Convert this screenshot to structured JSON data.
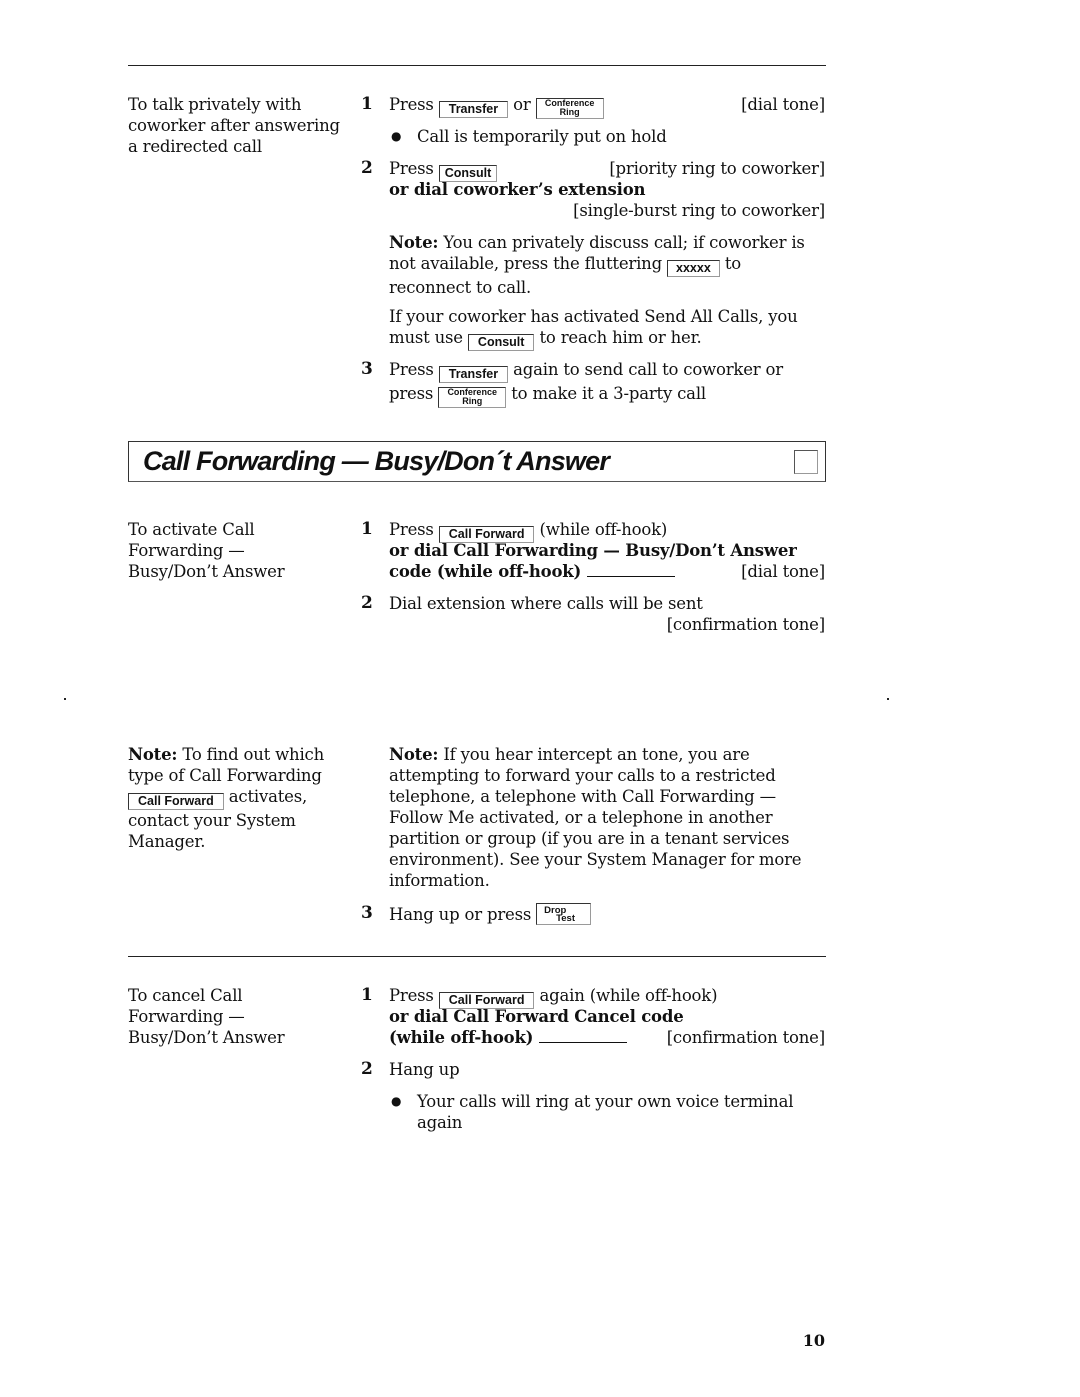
{
  "section1": {
    "left_text": [
      "To talk privately with",
      "coworker after answering",
      "a redirected call"
    ],
    "step1": {
      "number": "1",
      "press": "Press",
      "key_transfer": "Transfer",
      "or": "or",
      "key_conf_line1": "Conference",
      "key_conf_line2": "Ring",
      "tone": "[dial tone]"
    },
    "bullet1": "Call is temporarily put on hold",
    "step2": {
      "number": "2",
      "press": "Press",
      "key_consult": "Consult",
      "tone": "[priority ring to coworker]",
      "alt": "or dial coworker’s extension",
      "alt_tone": "[single-burst ring to coworker]"
    },
    "note1": {
      "label": "Note:",
      "line1": "You can privately discuss call; if coworker is",
      "line2_pre": "not available, press the fluttering",
      "key_xxxxx": "xxxxx",
      "line2_post": "to",
      "line3": "reconnect to call."
    },
    "note2": {
      "line1": "If your coworker has activated Send All Calls, you",
      "line2_pre": "must use",
      "key_consult": "Consult",
      "line2_post": "to reach him or her."
    },
    "step3": {
      "number": "3",
      "press": "Press",
      "key_transfer": "Transfer",
      "line1_post": "again to send call to coworker or",
      "press2": "press",
      "key_conf_line1": "Conference",
      "key_conf_line2": "Ring",
      "line2_post": "to make it a 3-party call"
    }
  },
  "heading": {
    "title": "Call Forwarding — Busy/Don´t Answer",
    "checkbox_icon": "empty-checkbox-icon"
  },
  "activate": {
    "left_text": [
      "To activate Call",
      "Forwarding —",
      "Busy/Don’t Answer"
    ],
    "step1": {
      "number": "1",
      "press": "Press",
      "key_call_forward": "Call Forward",
      "post": "(while off-hook)",
      "alt_line1": "or dial Call Forwarding — Busy/Don’t Answer",
      "alt_line2": "code (while off-hook)",
      "tone": "[dial tone]"
    },
    "step2": {
      "number": "2",
      "text": "Dial extension where calls will be sent",
      "tone": "[confirmation tone]"
    },
    "side_note": {
      "label": "Note:",
      "line1": "To find out which",
      "line2": "type of Call Forwarding",
      "key_call_forward": "Call Forward",
      "line3_post": "activates,",
      "line4": "contact your System",
      "line5": "Manager."
    },
    "note": {
      "label": "Note:",
      "line1": "If you hear intercept an tone, you are",
      "line2": "attempting to forward your calls to a restricted",
      "line3": "telephone, a telephone with Call Forwarding —",
      "line4": "Follow Me activated, or a telephone in another",
      "line5": "partition or group (if you are in a tenant services",
      "line6": "environment).  See your System Manager for more",
      "line7": "information."
    },
    "step3": {
      "number": "3",
      "text": "Hang up or press",
      "key_drop_line1": "Drop",
      "key_drop_line2": "Test"
    }
  },
  "cancel": {
    "left_text": [
      "To cancel Call",
      "Forwarding —",
      "Busy/Don’t Answer"
    ],
    "step1": {
      "number": "1",
      "press": "Press",
      "key_call_forward": "Call Forward",
      "post": "again (while off-hook)",
      "alt_line1": "or dial Call Forward Cancel code",
      "alt_line2": "(while off-hook)",
      "tone": "[confirmation tone]"
    },
    "step2": {
      "number": "2",
      "text": "Hang up"
    },
    "bullet": {
      "line1": "Your calls will ring at your own voice terminal",
      "line2": "again"
    }
  },
  "page_number": "10"
}
